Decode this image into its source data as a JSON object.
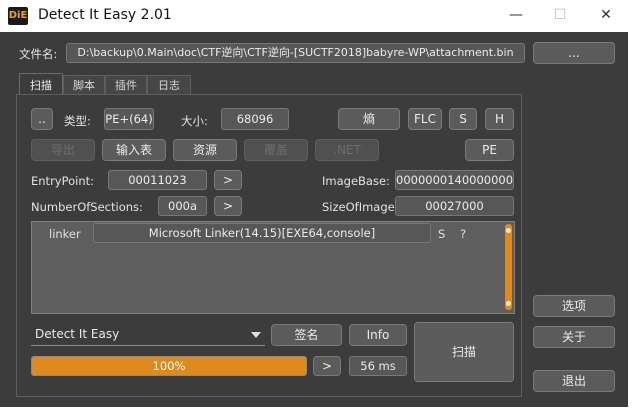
{
  "window": {
    "title": "Detect It Easy 2.01",
    "app_icon_text": "DiE",
    "minimize_glyph": "—",
    "maximize_glyph": "☐",
    "close_glyph": "✕"
  },
  "file": {
    "label": "文件名:",
    "path": "D:\\backup\\0.Main\\doc\\CTF逆向\\CTF逆向-[SUCTF2018]babyre-WP\\attachment.bin",
    "browse_label": "..."
  },
  "tabs": [
    {
      "label": "扫描",
      "active": true
    },
    {
      "label": "脚本",
      "active": false
    },
    {
      "label": "插件",
      "active": false
    },
    {
      "label": "日志",
      "active": false
    }
  ],
  "scan": {
    "dots_label": "..",
    "type_label": "类型:",
    "type_value": "PE+(64)",
    "size_label": "大小:",
    "size_value": "68096",
    "entropy_label": "熵",
    "flc_label": "FLC",
    "s_label": "S",
    "h_label": "H",
    "export_label": "导出",
    "import_label": "输入表",
    "resource_label": "资源",
    "overlay_label": "覆盖",
    "net_label": ".NET",
    "pe_label": "PE",
    "entrypoint_label": "EntryPoint:",
    "entrypoint_value": "00011023",
    "entrypoint_go": ">",
    "imagebase_label": "ImageBase:",
    "imagebase_value": "0000000140000000",
    "sections_label": "NumberOfSections:",
    "sections_value": "000a",
    "sections_go": ">",
    "sizeofimage_label": "SizeOfImage:",
    "sizeofimage_value": "00027000"
  },
  "results": [
    {
      "type": "linker",
      "value": "Microsoft Linker(14.15)[EXE64,console]",
      "s": "S",
      "q": "?"
    }
  ],
  "bottom": {
    "engine_value": "Detect It Easy",
    "signature_label": "签名",
    "info_label": "Info",
    "scan_label": "扫描",
    "progress_percent": 100,
    "progress_text": "100%",
    "next_label": ">",
    "time_label": "56 ms"
  },
  "side": {
    "options_label": "选项",
    "about_label": "关于",
    "exit_label": "退出"
  },
  "colors": {
    "accent": "#e08a1e",
    "window_bg": "#3c3c3c",
    "button_bg": "#5b5b5b"
  }
}
